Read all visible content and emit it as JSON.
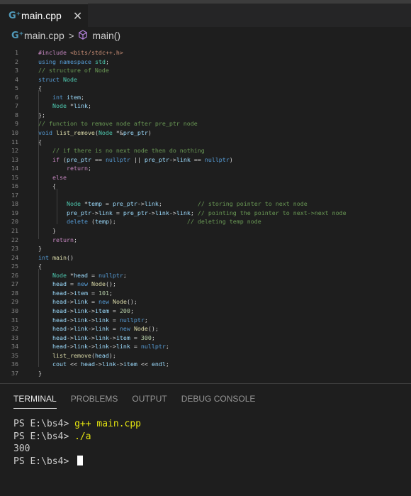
{
  "tab": {
    "icon": "cpp-file-icon",
    "icon_glyph": "G⁺",
    "label": "main.cpp",
    "close": "✕"
  },
  "breadcrumb": {
    "file": "main.cpp",
    "separator": ">",
    "symbol": "main()"
  },
  "editor": {
    "lines": [
      {
        "n": "1",
        "html": "<span class=\"pp\">#include</span> <span class=\"inc\">&lt;bits/stdc++.h&gt;</span>"
      },
      {
        "n": "2",
        "html": "<span class=\"kw\">using</span> <span class=\"kw\">namespace</span> <span class=\"ty\">std</span>;"
      },
      {
        "n": "3",
        "html": "<span class=\"cm\">// structure of Node</span>"
      },
      {
        "n": "4",
        "html": "<span class=\"kw\">struct</span> <span class=\"ty\">Node</span>"
      },
      {
        "n": "5",
        "html": "{"
      },
      {
        "n": "6",
        "html": "    <span class=\"kw\">int</span> <span class=\"va\">item</span>;"
      },
      {
        "n": "7",
        "html": "    <span class=\"ty\">Node</span> *<span class=\"va\">link</span>;"
      },
      {
        "n": "8",
        "html": "};"
      },
      {
        "n": "9",
        "html": "<span class=\"cm\">// function to remove node after pre_ptr node</span>"
      },
      {
        "n": "10",
        "html": "<span class=\"kw\">void</span> <span class=\"fn\">list_remove</span>(<span class=\"ty\">Node</span> *&amp;<span class=\"va\">pre_ptr</span>)"
      },
      {
        "n": "11",
        "html": "{"
      },
      {
        "n": "12",
        "html": "    <span class=\"cm\">// if there is no next node then do nothing</span>"
      },
      {
        "n": "13",
        "html": "    <span class=\"ctl\">if</span> (<span class=\"va\">pre_ptr</span> == <span class=\"kw\">nullptr</span> || <span class=\"va\">pre_ptr</span>-&gt;<span class=\"va\">link</span> == <span class=\"kw\">nullptr</span>)"
      },
      {
        "n": "14",
        "html": "        <span class=\"ctl\">return</span>;"
      },
      {
        "n": "15",
        "html": "    <span class=\"ctl\">else</span>"
      },
      {
        "n": "16",
        "html": "    {"
      },
      {
        "n": "17",
        "html": ""
      },
      {
        "n": "18",
        "html": "        <span class=\"ty\">Node</span> *<span class=\"va\">temp</span> = <span class=\"va\">pre_ptr</span>-&gt;<span class=\"va\">link</span>;          <span class=\"cm\">// storing pointer to next node</span>"
      },
      {
        "n": "19",
        "html": "        <span class=\"va\">pre_ptr</span>-&gt;<span class=\"va\">link</span> = <span class=\"va\">pre_ptr</span>-&gt;<span class=\"va\">link</span>-&gt;<span class=\"va\">link</span>; <span class=\"cm\">// pointing the pointer to next-&gt;next node</span>"
      },
      {
        "n": "20",
        "html": "        <span class=\"kw\">delete</span> (<span class=\"va\">temp</span>);                    <span class=\"cm\">// deleting temp node</span>"
      },
      {
        "n": "21",
        "html": "    }"
      },
      {
        "n": "22",
        "html": "    <span class=\"ctl\">return</span>;"
      },
      {
        "n": "23",
        "html": "}"
      },
      {
        "n": "24",
        "html": "<span class=\"kw\">int</span> <span class=\"fn\">main</span>()"
      },
      {
        "n": "25",
        "html": "{"
      },
      {
        "n": "26",
        "html": "    <span class=\"ty\">Node</span> *<span class=\"va\">head</span> = <span class=\"kw\">nullptr</span>;"
      },
      {
        "n": "27",
        "html": "    <span class=\"va\">head</span> = <span class=\"kw\">new</span> <span class=\"fn\">Node</span>();"
      },
      {
        "n": "28",
        "html": "    <span class=\"va\">head</span>-&gt;<span class=\"va\">item</span> = <span class=\"nu\">101</span>;"
      },
      {
        "n": "29",
        "html": "    <span class=\"va\">head</span>-&gt;<span class=\"va\">link</span> = <span class=\"kw\">new</span> <span class=\"fn\">Node</span>();"
      },
      {
        "n": "30",
        "html": "    <span class=\"va\">head</span>-&gt;<span class=\"va\">link</span>-&gt;<span class=\"va\">item</span> = <span class=\"nu\">200</span>;"
      },
      {
        "n": "31",
        "html": "    <span class=\"va\">head</span>-&gt;<span class=\"va\">link</span>-&gt;<span class=\"va\">link</span> = <span class=\"kw\">nullptr</span>;"
      },
      {
        "n": "32",
        "html": "    <span class=\"va\">head</span>-&gt;<span class=\"va\">link</span>-&gt;<span class=\"va\">link</span> = <span class=\"kw\">new</span> <span class=\"fn\">Node</span>();"
      },
      {
        "n": "33",
        "html": "    <span class=\"va\">head</span>-&gt;<span class=\"va\">link</span>-&gt;<span class=\"va\">link</span>-&gt;<span class=\"va\">item</span> = <span class=\"nu\">300</span>;"
      },
      {
        "n": "34",
        "html": "    <span class=\"va\">head</span>-&gt;<span class=\"va\">link</span>-&gt;<span class=\"va\">link</span>-&gt;<span class=\"va\">link</span> = <span class=\"kw\">nullptr</span>;"
      },
      {
        "n": "35",
        "html": "    <span class=\"fn\">list_remove</span>(<span class=\"va\">head</span>);"
      },
      {
        "n": "36",
        "html": "    <span class=\"va\">cout</span> &lt;&lt; <span class=\"va\">head</span>-&gt;<span class=\"va\">link</span>-&gt;<span class=\"va\">item</span> &lt;&lt; <span class=\"va\">endl</span>;"
      },
      {
        "n": "37",
        "html": "}"
      }
    ]
  },
  "panel": {
    "tabs": [
      "TERMINAL",
      "PROBLEMS",
      "OUTPUT",
      "DEBUG CONSOLE"
    ],
    "terminal": {
      "prompt1": "PS E:\\bs4> ",
      "cmd1": "g++ main.cpp",
      "prompt2": "PS E:\\bs4> ",
      "cmd2": "./a",
      "output": "300",
      "prompt3": "PS E:\\bs4> "
    }
  }
}
